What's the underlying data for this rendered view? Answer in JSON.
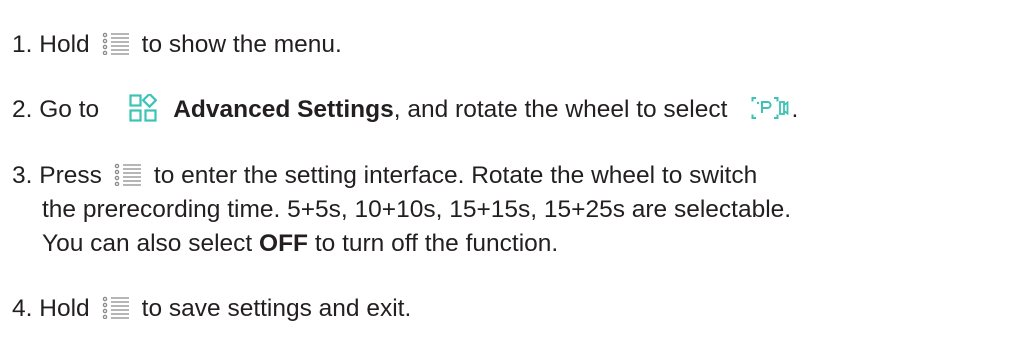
{
  "steps": [
    {
      "number": "1.",
      "before": "Hold",
      "icon": "menu-icon",
      "after": "to show the menu."
    },
    {
      "number": "2.",
      "before": "Go to",
      "icon": "advanced-settings-icon",
      "bold": "Advanced Settings",
      "middle": ", and rotate the wheel to select",
      "icon2": "prerecord-icon",
      "after": "."
    },
    {
      "number": "3.",
      "before": "Press",
      "icon": "menu-icon",
      "after": "to enter the setting interface. Rotate the wheel to switch",
      "line2": "the prerecording time. 5+5s, 10+10s, 15+15s, 15+25s are selectable.",
      "line3_before": "You can also select",
      "line3_bold": "OFF",
      "line3_after": "to turn off the function."
    },
    {
      "number": "4.",
      "before": "Hold",
      "icon": "menu-icon",
      "after": "to save settings and exit."
    }
  ],
  "colors": {
    "text": "#231f20",
    "icon_teal": "#3cc3b5",
    "icon_gray": "#8a8a8a"
  }
}
